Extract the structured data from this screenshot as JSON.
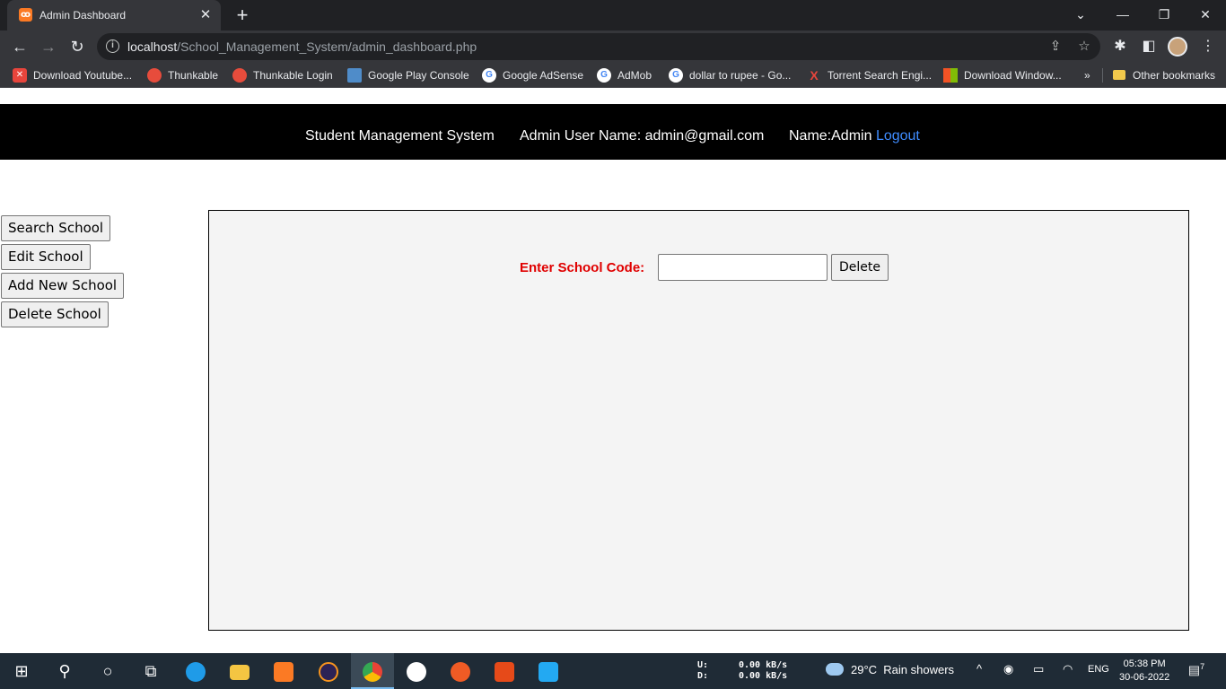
{
  "browser": {
    "tab_title": "Admin Dashboard",
    "tab_favicon_glyph": "ꝏ",
    "url_host": "localhost",
    "url_path": "/School_Management_System/admin_dashboard.php",
    "bookmarks": [
      {
        "label": "Download Youtube...",
        "icon_color": "#e8453c"
      },
      {
        "label": "Thunkable",
        "icon_color": "#e74c3c"
      },
      {
        "label": "Thunkable Login",
        "icon_color": "#e74c3c"
      },
      {
        "label": "Google Play Console",
        "icon_color": "#4f8cc9"
      },
      {
        "label": "Google AdSense",
        "icon_color": "#ffffff"
      },
      {
        "label": "AdMob",
        "icon_color": "#ffffff"
      },
      {
        "label": "dollar to rupee - Go...",
        "icon_color": "#ffffff"
      },
      {
        "label": "Torrent Search Engi...",
        "icon_color": "#e8453c"
      },
      {
        "label": "Download Window...",
        "icon_color": "#2196f3"
      }
    ],
    "bookmarks_overflow": "»",
    "other_bookmarks": "Other bookmarks"
  },
  "header": {
    "app_name": "Student Management System",
    "admin_user": "Admin User Name: admin@gmail.com",
    "name": "Name:Admin",
    "logout": "Logout"
  },
  "sidebar": {
    "buttons": [
      "Search School",
      "Edit School",
      "Add New School",
      "Delete School"
    ]
  },
  "panel": {
    "label": "Enter School Code:",
    "input_value": "",
    "input_placeholder": "",
    "button": "Delete"
  },
  "taskbar": {
    "net_up_label": "U:",
    "net_down_label": "D:",
    "net_up": "0.00 kB/s",
    "net_down": "0.00 kB/s",
    "weather_temp": "29°C",
    "weather_text": "Rain showers",
    "lang": "ENG",
    "time": "05:38 PM",
    "date": "30-06-2022",
    "notifications": "7"
  },
  "colors": {
    "header_bg": "#000000",
    "logout_link": "#3f8cff",
    "label_red": "#e00000",
    "panel_bg": "#f4f4f4"
  }
}
